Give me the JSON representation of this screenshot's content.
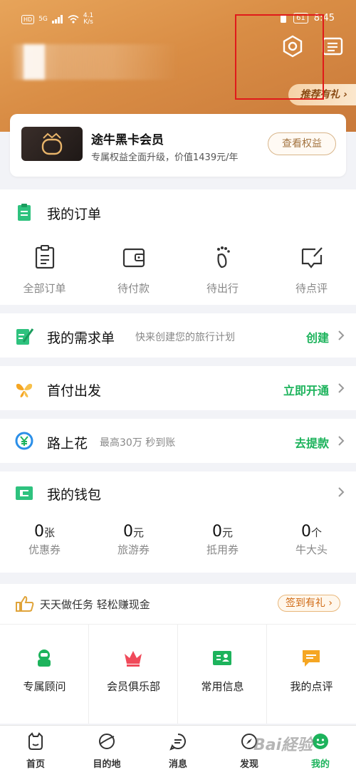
{
  "status_bar": {
    "hd": "HD",
    "signal": "5G",
    "net_speed": "4.1",
    "net_unit": "K/s",
    "battery": "61",
    "time": "8:45"
  },
  "header": {
    "promo": "推荐有礼"
  },
  "member": {
    "title": "途牛黑卡会员",
    "subtitle": "专属权益全面升级，价值1439元/年",
    "button": "查看权益"
  },
  "orders": {
    "title": "我的订单",
    "items": [
      {
        "label": "全部订单",
        "icon": "order-list-icon"
      },
      {
        "label": "待付款",
        "icon": "wallet-icon"
      },
      {
        "label": "待出行",
        "icon": "footprint-icon"
      },
      {
        "label": "待点评",
        "icon": "review-icon"
      }
    ]
  },
  "demand": {
    "title": "我的需求单",
    "hint": "快来创建您的旅行计划",
    "action": "创建"
  },
  "first_pay": {
    "title": "首付出发",
    "action": "立即开通"
  },
  "road": {
    "title": "路上花",
    "hint": "最高30万 秒到账",
    "action": "去提款"
  },
  "wallet": {
    "title": "我的钱包",
    "items": [
      {
        "value": "0",
        "unit": "张",
        "label": "优惠券"
      },
      {
        "value": "0",
        "unit": "元",
        "label": "旅游券"
      },
      {
        "value": "0",
        "unit": "元",
        "label": "抵用券"
      },
      {
        "value": "0",
        "unit": "个",
        "label": "牛大头"
      }
    ]
  },
  "task": {
    "text": "天天做任务  轻松赚现金",
    "button": "签到有礼"
  },
  "tools": [
    {
      "label": "专属顾问",
      "icon": "advisor-icon",
      "color": "#1db35c"
    },
    {
      "label": "会员俱乐部",
      "icon": "crown-icon",
      "color": "#f04a5a"
    },
    {
      "label": "常用信息",
      "icon": "id-card-icon",
      "color": "#1db35c"
    },
    {
      "label": "我的点评",
      "icon": "comment-icon",
      "color": "#f5a623"
    }
  ],
  "tabbar": [
    {
      "label": "首页",
      "icon": "home-icon"
    },
    {
      "label": "目的地",
      "icon": "planet-icon"
    },
    {
      "label": "消息",
      "icon": "message-icon"
    },
    {
      "label": "发现",
      "icon": "compass-icon"
    },
    {
      "label": "我的",
      "icon": "profile-icon",
      "active": true
    }
  ],
  "watermark": "Bai経验",
  "colors": {
    "accent": "#1db35c",
    "header": "#d98d45",
    "highlight": "#e01a1a"
  }
}
